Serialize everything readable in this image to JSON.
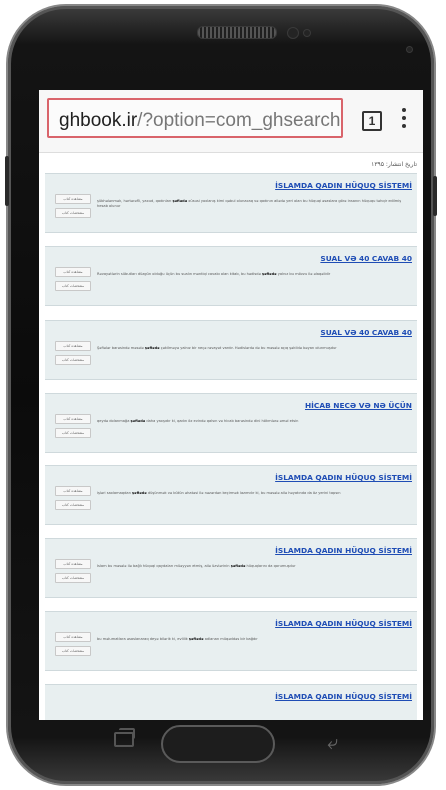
{
  "browser": {
    "url_host": "ghbook.ir",
    "url_path": "/?option=com_ghsearch",
    "tab_count": "1"
  },
  "page": {
    "date_label": "تاریخ انتشار: ۱۳۹۵",
    "results": [
      {
        "title": "İSLAMDA QADIN HÜQUQ SİSTEMİ",
        "snippet_pre": "şübhələnmək, hərtərəfli, yaxud, qadınları ",
        "keyword": "şəfiədə",
        "snippet_post": " xüsusi yoxlanış kimi qəbul olunacaq və qadının ailədə yeri olan bu hüquqi əsaslara görə insanın hüququ təhqir edilmiş hesab olunur",
        "btn1": "مشاهده کتاب",
        "btn2": "مشخصات کتاب"
      },
      {
        "title": "SUAL VƏ 40 CAVAB 40",
        "snippet_pre": "Rəvayətlərin sübutları düzgün olduğu üçün bu sualın məntiqi cavabı olan kitab, bu hədisdə ",
        "keyword": "şəfiədə",
        "snippet_post": " yalnız bu mövzu ilə əlaqəlidir",
        "btn1": "مشاهده کتاب",
        "btn2": "مشخصات کتاب"
      },
      {
        "title": "SUAL VƏ 40 CAVAB 40",
        "snippet_pre": "Şəfiələr barəsində məsələ ",
        "keyword": "şəfiədə",
        "snippet_post": " çəkilməyə yalnız bir neçə rəvayət vardır. Hədislərdə də bu məsələ açıq şəkildə bəyan olunmuşdur",
        "btn1": "مشاهده کتاب",
        "btn2": "مشخصات کتاب"
      },
      {
        "title": "HİCAB NECƏ VƏ NƏ ÜÇÜN",
        "snippet_pre": "qeydə dolanmağa ",
        "keyword": "şəfiədə",
        "snippet_post": " daha yaxşıdır ki, qadın öz evində qalsın və hicab barəsində dini hökmlərə əməl etsin",
        "btn1": "مشاهده کتاب",
        "btn2": "مشخصات کتاب"
      },
      {
        "title": "İSLAMDA QADIN HÜQUQ SİSTEMİ",
        "snippet_pre": "işləri saxlamaqdan ",
        "keyword": "şəfiədə",
        "snippet_post": " düşünmək və bütün əhatəsi ilə nəzərdən keçirmək lazımdır ki, bu məsələ ailə həyatında da öz yerini tapsın",
        "btn1": "مشاهده کتاب",
        "btn2": "مشخصات کتاب"
      },
      {
        "title": "İSLAMDA QADIN HÜQUQ SİSTEMİ",
        "snippet_pre": "İslam bu məsələ ilə bağlı hüquqi qaydaları müəyyən etmiş, ailə üzvlərinin ",
        "keyword": "şəfiədə",
        "snippet_post": " hüquqlarını da qorumuşdur",
        "btn1": "مشاهده کتاب",
        "btn2": "مشخصات کتاب"
      },
      {
        "title": "İSLAMDA QADIN HÜQUQ SİSTEMİ",
        "snippet_pre": "bu məlumatlara əsaslanaraq deyə bilərik ki, evlilik ",
        "keyword": "şəfiədə",
        "snippet_post": " adlanan müqəddəs bir bağdır",
        "btn1": "مشاهده کتاب",
        "btn2": "مشخصات کتاب"
      },
      {
        "title": "İSLAMDA QADIN HÜQUQ SİSTEMİ",
        "snippet_pre": "",
        "keyword": "",
        "snippet_post": "",
        "btn1": "",
        "btn2": ""
      }
    ]
  }
}
